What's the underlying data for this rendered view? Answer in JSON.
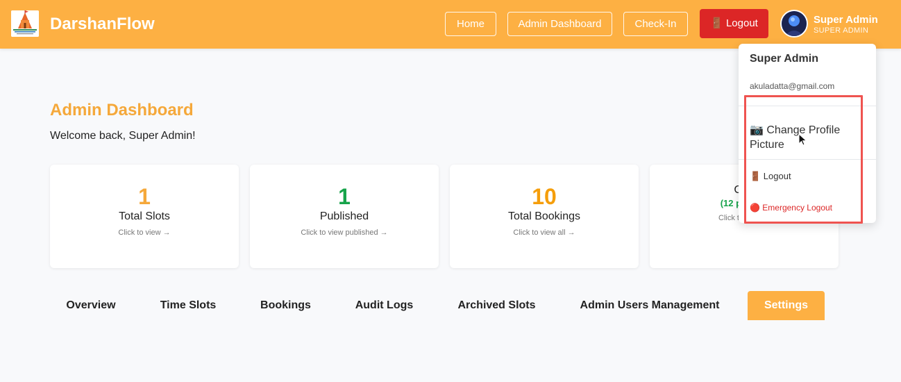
{
  "app": {
    "brand": "DarshanFlow",
    "accent_color": "#fdb043",
    "danger_color": "#dc2626"
  },
  "nav": {
    "home": "Home",
    "admin_dashboard": "Admin Dashboard",
    "check_in": "Check-In",
    "logout": "🚪 Logout"
  },
  "user": {
    "name": "Super Admin",
    "role": "SUPER ADMIN",
    "email": "akuladatta@gmail.com"
  },
  "page": {
    "title": "Admin Dashboard",
    "welcome": "Welcome back, Super Admin!"
  },
  "stats": [
    {
      "value": "1",
      "label": "Total Slots",
      "hint": "Click to view →",
      "color": "#f5a83a"
    },
    {
      "value": "1",
      "label": "Published",
      "hint": "Click to view published →",
      "color": "#16a34a"
    },
    {
      "value": "10",
      "label": "Total Bookings",
      "hint": "Click to view all →",
      "color": "#f59e0b"
    },
    {
      "value": "",
      "label": "Che",
      "sub": "(12 people)",
      "hint": "Click to filter →",
      "color": "#16a34a"
    }
  ],
  "tabs": [
    "Overview",
    "Time Slots",
    "Bookings",
    "Audit Logs",
    "Archived Slots",
    "Admin Users Management",
    "Settings"
  ],
  "active_tab": "Settings",
  "dropdown": {
    "name": "Super Admin",
    "email": "akuladatta@gmail.com",
    "change_picture": "📷 Change Profile Picture",
    "logout": "🚪 Logout",
    "emergency_logout": "🔴 Emergency Logout"
  }
}
